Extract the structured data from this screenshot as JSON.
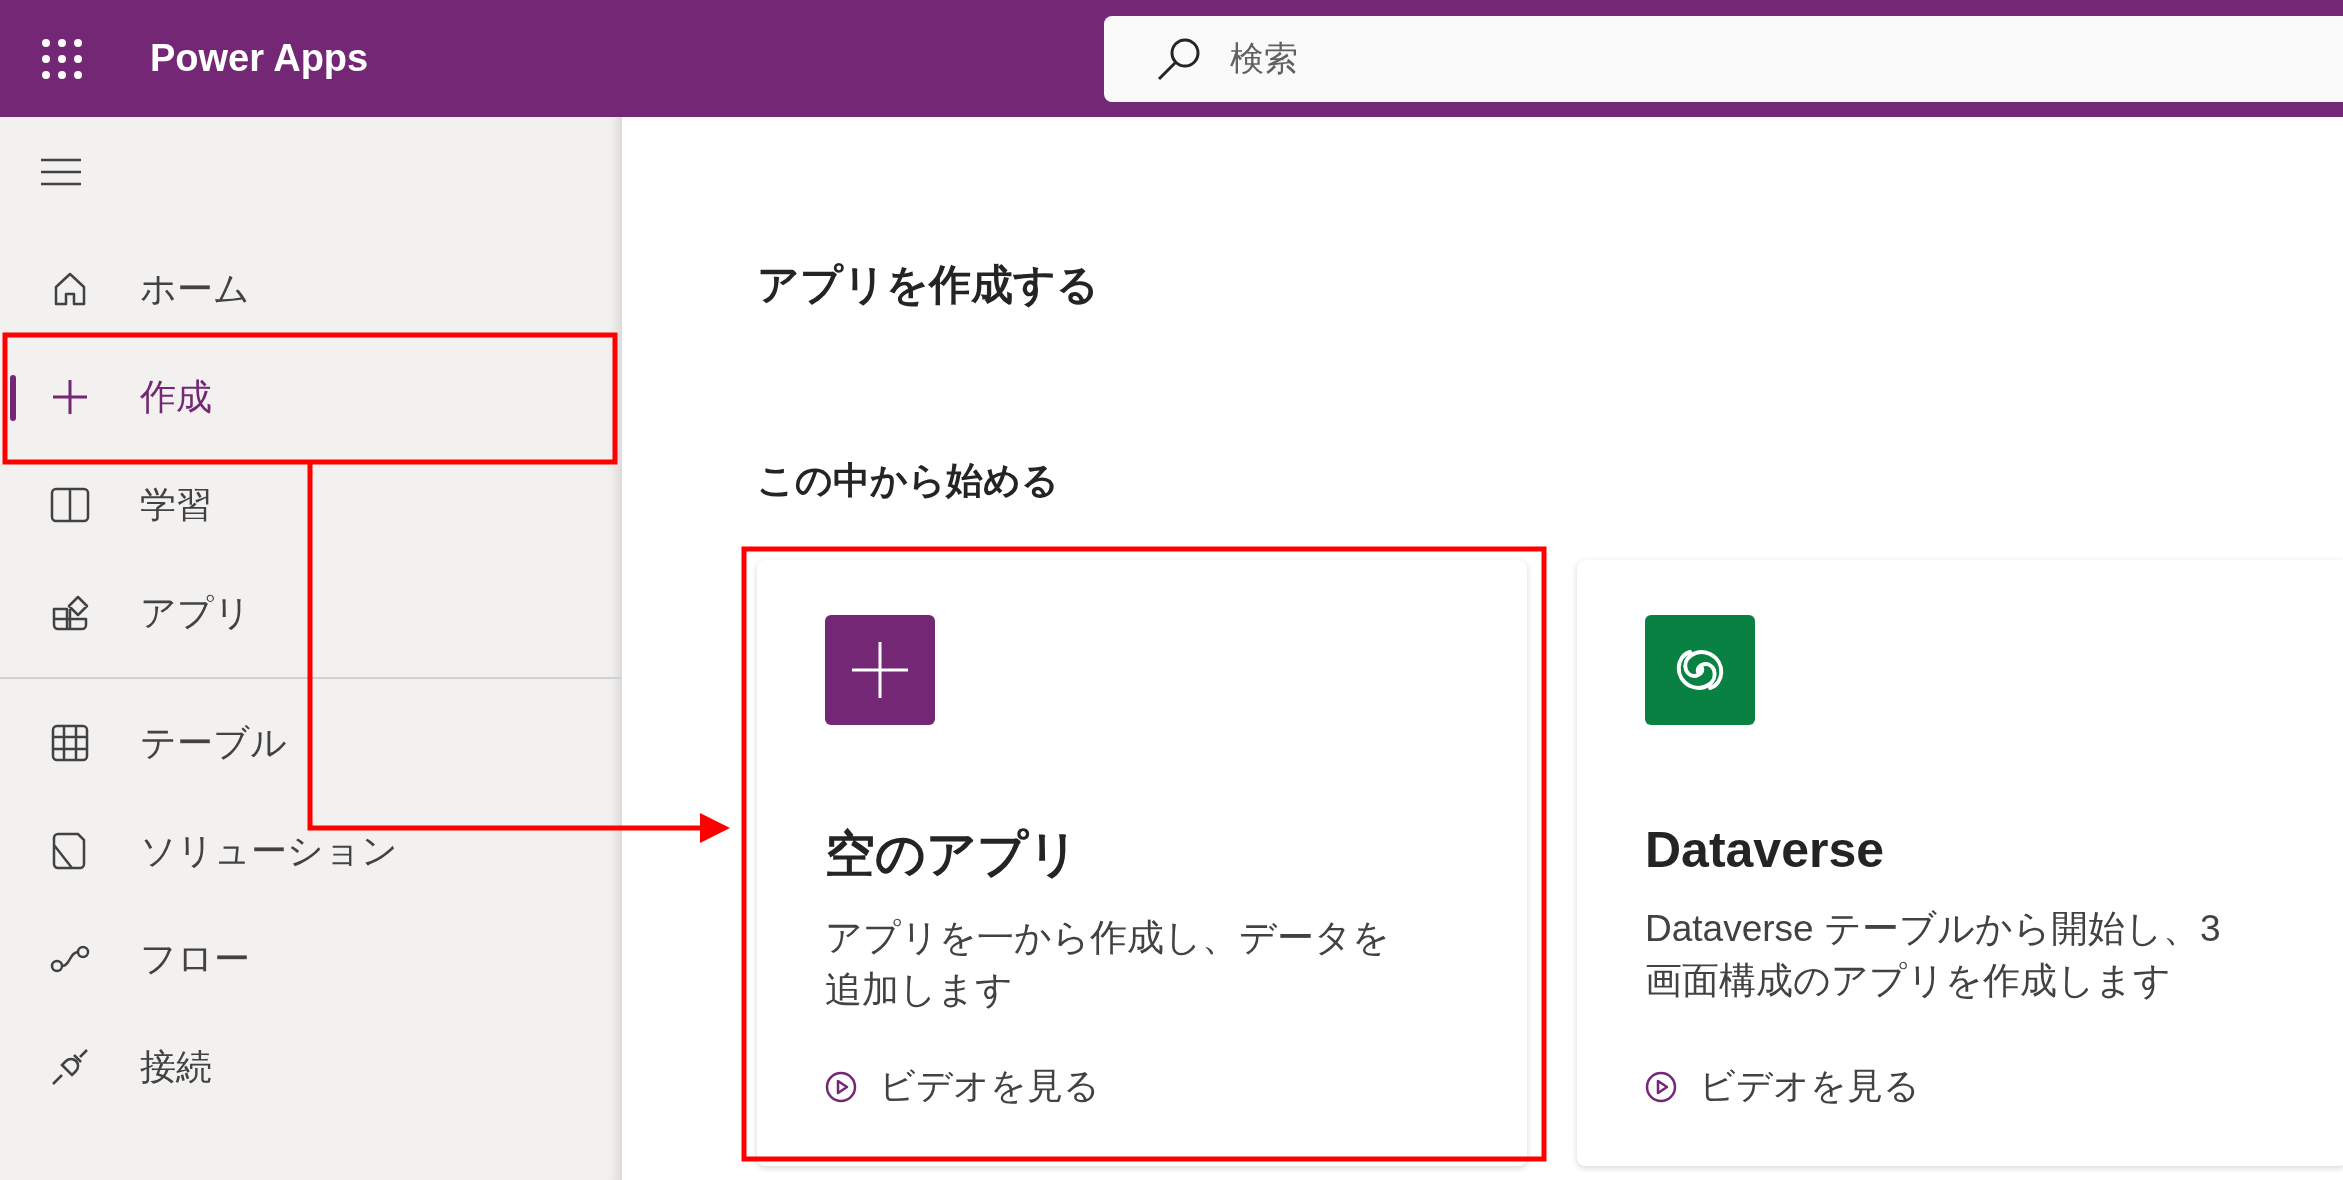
{
  "header": {
    "app_name": "Power Apps",
    "search": {
      "placeholder": "検索"
    }
  },
  "sidebar": {
    "nav_groups": [
      [
        {
          "label": "ホーム",
          "selected": false
        },
        {
          "label": "作成",
          "selected": true
        },
        {
          "label": "学習",
          "selected": false
        },
        {
          "label": "アプリ",
          "selected": false
        }
      ],
      [
        {
          "label": "テーブル",
          "selected": false
        },
        {
          "label": "ソリューション",
          "selected": false
        },
        {
          "label": "フロー",
          "selected": false
        },
        {
          "label": "接続",
          "selected": false
        }
      ]
    ]
  },
  "main": {
    "title": "アプリを作成する",
    "section_title": "この中から始める",
    "cards": [
      {
        "kind": "blank",
        "title": "空のアプリ",
        "description": "アプリを一から作成し、データを追加します",
        "video_link": "ビデオを見る"
      },
      {
        "kind": "dataverse",
        "title": "Dataverse",
        "description": "Dataverse テーブルから開始し、3 画面構成のアプリを作成します",
        "video_link": "ビデオを見る"
      }
    ]
  }
}
